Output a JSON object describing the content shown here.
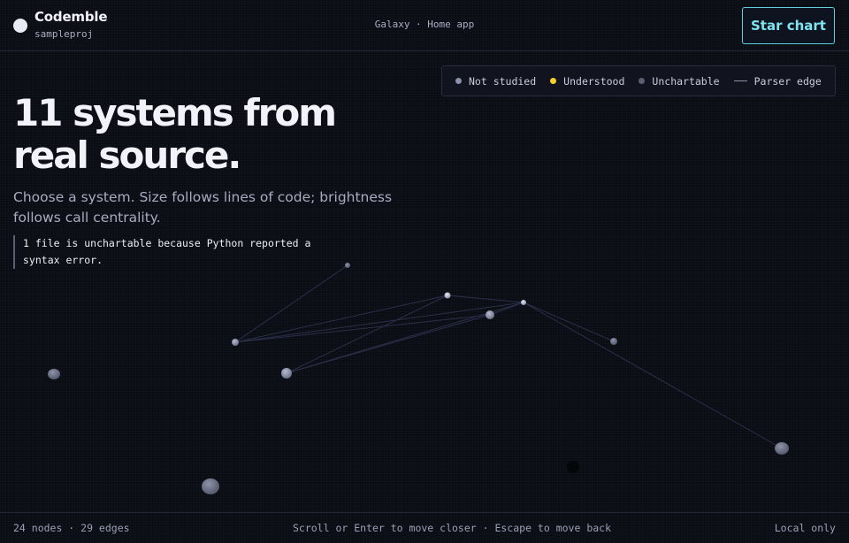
{
  "header": {
    "brand_name": "Codemble",
    "project": "sampleproj",
    "breadcrumb": "Galaxy · Home app",
    "star_chart_label": "Star chart"
  },
  "legend": {
    "items": [
      {
        "label": "Not studied",
        "color": "#8b91a8",
        "icon": "dot"
      },
      {
        "label": "Understood",
        "color": "#f5d02b",
        "icon": "dot"
      },
      {
        "label": "Unchartable",
        "color": "#5a5f72",
        "icon": "dot"
      },
      {
        "label": "Parser edge",
        "color": "#8a90a6",
        "icon": "line"
      }
    ]
  },
  "hero": {
    "title": "11 systems from real source.",
    "subtitle": "Choose a system. Size follows lines of code; brightness follows call centrality.",
    "notice": "1 file is unchartable because Python reported a syntax error."
  },
  "footer": {
    "stats": "24 nodes · 29 edges",
    "hint": "Scroll or Enter to move closer · Escape to move back",
    "mode": "Local only"
  },
  "colors": {
    "background": "#0b0d15",
    "accent": "#5ed0e0"
  }
}
